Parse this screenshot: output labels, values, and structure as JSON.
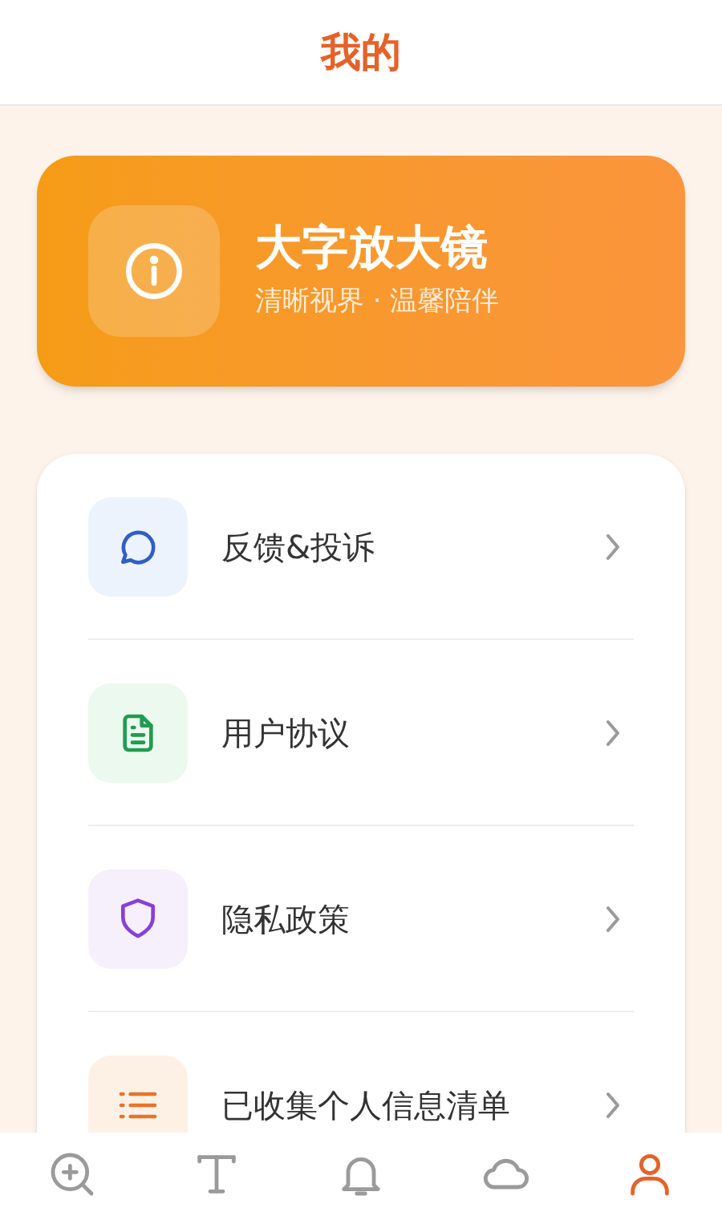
{
  "header": {
    "title": "我的"
  },
  "banner": {
    "title": "大字放大镜",
    "subtitle": "清晰视界 · 温馨陪伴"
  },
  "menu": [
    {
      "kind": "chat",
      "label": "反馈&投诉",
      "color": "#2f5fc4"
    },
    {
      "kind": "document",
      "label": "用户协议",
      "color": "#1f9d4f"
    },
    {
      "kind": "shield",
      "label": "隐私政策",
      "color": "#8a3fd8"
    },
    {
      "kind": "list",
      "label": "已收集个人信息清单",
      "color": "#e8742a"
    }
  ],
  "tab_bar": [
    {
      "kind": "magnifier",
      "selected": false
    },
    {
      "kind": "text",
      "selected": false
    },
    {
      "kind": "bell",
      "selected": false
    },
    {
      "kind": "cloud",
      "selected": false
    },
    {
      "kind": "person",
      "selected": true
    }
  ]
}
